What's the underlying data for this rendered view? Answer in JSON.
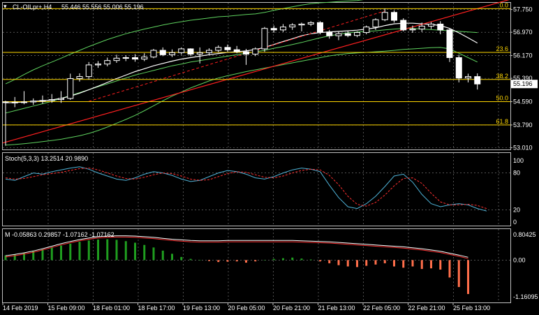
{
  "header": {
    "symbol_label": "CL-OILpr+,H4",
    "ohlc_label": "55.446 55.556 55.006 55.196"
  },
  "price_axis": {
    "ticks": [
      57.75,
      56.97,
      56.17,
      55.39,
      54.59,
      53.79,
      53.01
    ],
    "tick_labels": [
      "57.750",
      "56.970",
      "56.170",
      "55.390",
      "54.590",
      "53.790",
      "53.010"
    ],
    "range": [
      52.95,
      57.98
    ],
    "current_price": "55.196"
  },
  "fibonacci": {
    "levels": [
      {
        "label": "0.0",
        "price": 57.78
      },
      {
        "label": "23.6",
        "price": 56.28
      },
      {
        "label": "38.2",
        "price": 55.35
      },
      {
        "label": "50.0",
        "price": 54.59
      },
      {
        "label": "61.8",
        "price": 53.79
      }
    ]
  },
  "stoch": {
    "label": "Stoch(5,3,3) 13.2514 20.9890",
    "ticks": [
      100,
      80,
      20,
      0
    ],
    "tick_labels": [
      "100",
      "80",
      "20",
      "0"
    ]
  },
  "macd": {
    "label": "M -0.05863 0.29857 -1.07162 -1.07162",
    "ticks": [
      0.80425,
      0.0,
      -1.16095
    ],
    "tick_labels": [
      "0.80425",
      "0.00",
      "-1.16095"
    ]
  },
  "time_axis": {
    "labels": [
      "14 Feb 2019",
      "15 Feb 09:00",
      "18 Feb 01:00",
      "18 Feb 17:00",
      "19 Feb 13:00",
      "20 Feb 05:00",
      "20 Feb 21:00",
      "21 Feb 13:00",
      "22 Feb 05:00",
      "22 Feb 21:00",
      "25 Feb 13:00"
    ]
  },
  "colors": {
    "background": "#000000",
    "grid": "#c0c0c0",
    "bull_candle": "#ffffff",
    "bear_candle": "#000000",
    "candle_outline": "#ffffff",
    "fib": "#ffd700",
    "bollinger": "#5fd35f",
    "ma_fast": "#ffffff",
    "trend_red": "#ff2020",
    "stoch_main": "#4fb3d8",
    "stoch_signal": "#ff3030",
    "macd_pos": "#1f9d1f",
    "macd_neg": "#ff6e4a",
    "macd_signal": "#ff3030"
  },
  "chart_data": {
    "type": "candlestick",
    "symbol": "CL-OILpr+",
    "timeframe": "H4",
    "candles": [
      {
        "o": 54.58,
        "h": 54.62,
        "l": 53.08,
        "c": 54.56
      },
      {
        "o": 54.56,
        "h": 54.75,
        "l": 54.4,
        "c": 54.57
      },
      {
        "o": 54.57,
        "h": 54.95,
        "l": 54.5,
        "c": 54.58
      },
      {
        "o": 54.58,
        "h": 54.7,
        "l": 54.48,
        "c": 54.61
      },
      {
        "o": 54.61,
        "h": 54.8,
        "l": 54.52,
        "c": 54.63
      },
      {
        "o": 54.63,
        "h": 54.85,
        "l": 54.55,
        "c": 54.66
      },
      {
        "o": 54.66,
        "h": 54.95,
        "l": 54.55,
        "c": 54.7
      },
      {
        "o": 54.7,
        "h": 55.55,
        "l": 54.65,
        "c": 55.38
      },
      {
        "o": 55.38,
        "h": 55.56,
        "l": 55.28,
        "c": 55.45
      },
      {
        "o": 55.45,
        "h": 55.95,
        "l": 55.35,
        "c": 55.85
      },
      {
        "o": 55.85,
        "h": 55.98,
        "l": 55.75,
        "c": 55.88
      },
      {
        "o": 55.88,
        "h": 56.1,
        "l": 55.8,
        "c": 56.0
      },
      {
        "o": 56.0,
        "h": 56.2,
        "l": 55.92,
        "c": 56.08
      },
      {
        "o": 56.08,
        "h": 56.18,
        "l": 55.98,
        "c": 56.1
      },
      {
        "o": 56.1,
        "h": 56.22,
        "l": 55.96,
        "c": 56.05
      },
      {
        "o": 56.05,
        "h": 56.25,
        "l": 55.98,
        "c": 56.12
      },
      {
        "o": 56.12,
        "h": 56.4,
        "l": 56.08,
        "c": 56.35
      },
      {
        "o": 56.35,
        "h": 56.45,
        "l": 56.15,
        "c": 56.2
      },
      {
        "o": 56.2,
        "h": 56.38,
        "l": 56.12,
        "c": 56.27
      },
      {
        "o": 56.27,
        "h": 56.45,
        "l": 56.2,
        "c": 56.4
      },
      {
        "o": 56.4,
        "h": 56.42,
        "l": 56.15,
        "c": 56.22
      },
      {
        "o": 56.22,
        "h": 56.45,
        "l": 55.9,
        "c": 56.27
      },
      {
        "o": 56.27,
        "h": 56.42,
        "l": 56.2,
        "c": 56.35
      },
      {
        "o": 56.35,
        "h": 56.52,
        "l": 56.28,
        "c": 56.45
      },
      {
        "o": 56.45,
        "h": 56.55,
        "l": 56.3,
        "c": 56.37
      },
      {
        "o": 56.37,
        "h": 56.5,
        "l": 56.25,
        "c": 56.3
      },
      {
        "o": 56.3,
        "h": 56.4,
        "l": 55.85,
        "c": 56.22
      },
      {
        "o": 56.22,
        "h": 56.45,
        "l": 56.15,
        "c": 56.4
      },
      {
        "o": 56.4,
        "h": 57.15,
        "l": 56.3,
        "c": 57.1
      },
      {
        "o": 57.1,
        "h": 57.2,
        "l": 56.95,
        "c": 57.05
      },
      {
        "o": 57.05,
        "h": 57.25,
        "l": 56.98,
        "c": 57.15
      },
      {
        "o": 57.15,
        "h": 57.28,
        "l": 57.05,
        "c": 57.22
      },
      {
        "o": 57.22,
        "h": 57.3,
        "l": 57.0,
        "c": 57.25
      },
      {
        "o": 57.25,
        "h": 57.35,
        "l": 57.18,
        "c": 57.3
      },
      {
        "o": 57.3,
        "h": 57.35,
        "l": 56.9,
        "c": 56.98
      },
      {
        "o": 56.98,
        "h": 57.05,
        "l": 56.75,
        "c": 56.85
      },
      {
        "o": 56.85,
        "h": 56.98,
        "l": 56.7,
        "c": 56.92
      },
      {
        "o": 56.92,
        "h": 57.02,
        "l": 56.8,
        "c": 56.86
      },
      {
        "o": 56.86,
        "h": 57.0,
        "l": 56.8,
        "c": 56.96
      },
      {
        "o": 56.96,
        "h": 57.2,
        "l": 56.9,
        "c": 57.15
      },
      {
        "o": 57.15,
        "h": 57.45,
        "l": 57.05,
        "c": 57.4
      },
      {
        "o": 57.4,
        "h": 57.78,
        "l": 57.35,
        "c": 57.65
      },
      {
        "o": 57.65,
        "h": 57.72,
        "l": 57.3,
        "c": 57.38
      },
      {
        "o": 57.38,
        "h": 57.45,
        "l": 57.0,
        "c": 57.05
      },
      {
        "o": 57.05,
        "h": 57.2,
        "l": 56.95,
        "c": 57.08
      },
      {
        "o": 57.08,
        "h": 57.3,
        "l": 56.98,
        "c": 57.18
      },
      {
        "o": 57.18,
        "h": 57.32,
        "l": 57.08,
        "c": 57.25
      },
      {
        "o": 57.25,
        "h": 57.35,
        "l": 56.9,
        "c": 57.05
      },
      {
        "o": 57.05,
        "h": 57.1,
        "l": 55.95,
        "c": 56.1
      },
      {
        "o": 56.1,
        "h": 56.2,
        "l": 55.25,
        "c": 55.4
      },
      {
        "o": 55.4,
        "h": 55.55,
        "l": 55.25,
        "c": 55.45
      },
      {
        "o": 55.45,
        "h": 55.56,
        "l": 55.006,
        "c": 55.196
      }
    ],
    "bollinger_upper": [
      55.2,
      55.35,
      55.52,
      55.68,
      55.82,
      55.95,
      56.08,
      56.22,
      56.35,
      56.48,
      56.6,
      56.72,
      56.82,
      56.92,
      57.0,
      57.08,
      57.15,
      57.22,
      57.28,
      57.33,
      57.38,
      57.42,
      57.46,
      57.5,
      57.52,
      57.55,
      57.58,
      57.6,
      57.65,
      57.72,
      57.78,
      57.84,
      57.9,
      57.95,
      57.98,
      58.0,
      58.02,
      58.04,
      58.06,
      58.1,
      58.15,
      58.22,
      58.3,
      58.38,
      58.45,
      58.52,
      58.58,
      58.62,
      58.65,
      58.68,
      58.7,
      58.72
    ],
    "bollinger_middle": [
      54.2,
      54.28,
      54.36,
      54.44,
      54.52,
      54.6,
      54.7,
      54.8,
      54.9,
      55.0,
      55.1,
      55.2,
      55.3,
      55.4,
      55.5,
      55.58,
      55.66,
      55.74,
      55.82,
      55.88,
      55.95,
      56.0,
      56.05,
      56.1,
      56.15,
      56.2,
      56.25,
      56.3,
      56.35,
      56.42,
      56.48,
      56.55,
      56.62,
      56.7,
      56.78,
      56.85,
      56.9,
      56.95,
      56.98,
      57.0,
      57.02,
      57.05,
      57.08,
      57.1,
      57.1,
      57.08,
      57.06,
      57.04,
      57.02,
      57.0,
      56.98,
      56.96
    ],
    "bollinger_lower": [
      53.1,
      53.12,
      53.15,
      53.18,
      53.22,
      53.26,
      53.3,
      53.36,
      53.42,
      53.5,
      53.6,
      53.72,
      53.85,
      53.98,
      54.12,
      54.28,
      54.45,
      54.62,
      54.78,
      54.92,
      55.06,
      55.18,
      55.3,
      55.4,
      55.48,
      55.55,
      55.62,
      55.68,
      55.74,
      55.8,
      55.86,
      55.92,
      55.98,
      56.04,
      56.1,
      56.16,
      56.2,
      56.24,
      56.26,
      56.28,
      56.3,
      56.32,
      56.35,
      56.38,
      56.4,
      56.42,
      56.44,
      56.45,
      56.4,
      56.25,
      56.1,
      55.95
    ],
    "ma_fast": [
      54.55,
      54.56,
      54.58,
      54.6,
      54.62,
      54.65,
      54.7,
      54.78,
      54.88,
      55.0,
      55.12,
      55.25,
      55.38,
      55.5,
      55.62,
      55.72,
      55.82,
      55.9,
      55.98,
      56.05,
      56.1,
      56.15,
      56.2,
      56.24,
      56.28,
      56.3,
      56.33,
      56.38,
      56.45,
      56.55,
      56.65,
      56.75,
      56.85,
      56.92,
      56.96,
      56.98,
      57.0,
      57.02,
      57.04,
      57.08,
      57.12,
      57.2,
      57.26,
      57.28,
      57.28,
      57.26,
      57.24,
      57.2,
      57.1,
      56.95,
      56.78,
      56.6
    ],
    "trend_line": {
      "start": {
        "bar": 0,
        "price": 53.2
      },
      "end": {
        "bar": 51,
        "price": 57.78
      }
    },
    "stoch_main": [
      70,
      68,
      74,
      80,
      78,
      82,
      85,
      88,
      90,
      86,
      80,
      75,
      70,
      68,
      72,
      78,
      82,
      80,
      76,
      70,
      66,
      68,
      74,
      80,
      84,
      82,
      78,
      72,
      70,
      74,
      80,
      85,
      88,
      86,
      82,
      60,
      40,
      25,
      22,
      30,
      42,
      58,
      75,
      78,
      65,
      45,
      30,
      25,
      28,
      30,
      28,
      22,
      18
    ],
    "stoch_signal": [
      72,
      70,
      71,
      74,
      77,
      79,
      81,
      84,
      87,
      88,
      85,
      80,
      75,
      71,
      70,
      73,
      77,
      80,
      79,
      75,
      70,
      68,
      69,
      74,
      79,
      82,
      81,
      77,
      73,
      72,
      75,
      80,
      84,
      86,
      85,
      76,
      61,
      42,
      29,
      26,
      32,
      44,
      59,
      71,
      72,
      63,
      47,
      33,
      28,
      28,
      29,
      27,
      22
    ],
    "macd_hist": [
      0.15,
      0.18,
      0.22,
      0.28,
      0.34,
      0.4,
      0.46,
      0.52,
      0.58,
      0.62,
      0.65,
      0.66,
      0.64,
      0.6,
      0.55,
      0.48,
      0.4,
      0.3,
      0.2,
      0.1,
      0.04,
      0.0,
      -0.03,
      -0.06,
      -0.05,
      -0.04,
      -0.08,
      -0.04,
      0.0,
      0.04,
      0.06,
      0.08,
      0.05,
      0.02,
      -0.04,
      -0.1,
      -0.16,
      -0.2,
      -0.22,
      -0.18,
      -0.14,
      -0.1,
      -0.2,
      -0.24,
      -0.2,
      -0.28,
      -0.26,
      -0.3,
      -0.55,
      -0.85,
      -1.07162
    ],
    "macd_signal": [
      0.1,
      0.14,
      0.19,
      0.25,
      0.32,
      0.4,
      0.48,
      0.55,
      0.61,
      0.66,
      0.7,
      0.72,
      0.73,
      0.73,
      0.72,
      0.7,
      0.68,
      0.65,
      0.62,
      0.6,
      0.58,
      0.57,
      0.57,
      0.57,
      0.58,
      0.58,
      0.58,
      0.58,
      0.58,
      0.58,
      0.58,
      0.58,
      0.57,
      0.56,
      0.55,
      0.54,
      0.52,
      0.5,
      0.48,
      0.46,
      0.44,
      0.42,
      0.4,
      0.38,
      0.35,
      0.32,
      0.28,
      0.24,
      0.18,
      0.12,
      0.05,
      0.29857
    ]
  }
}
